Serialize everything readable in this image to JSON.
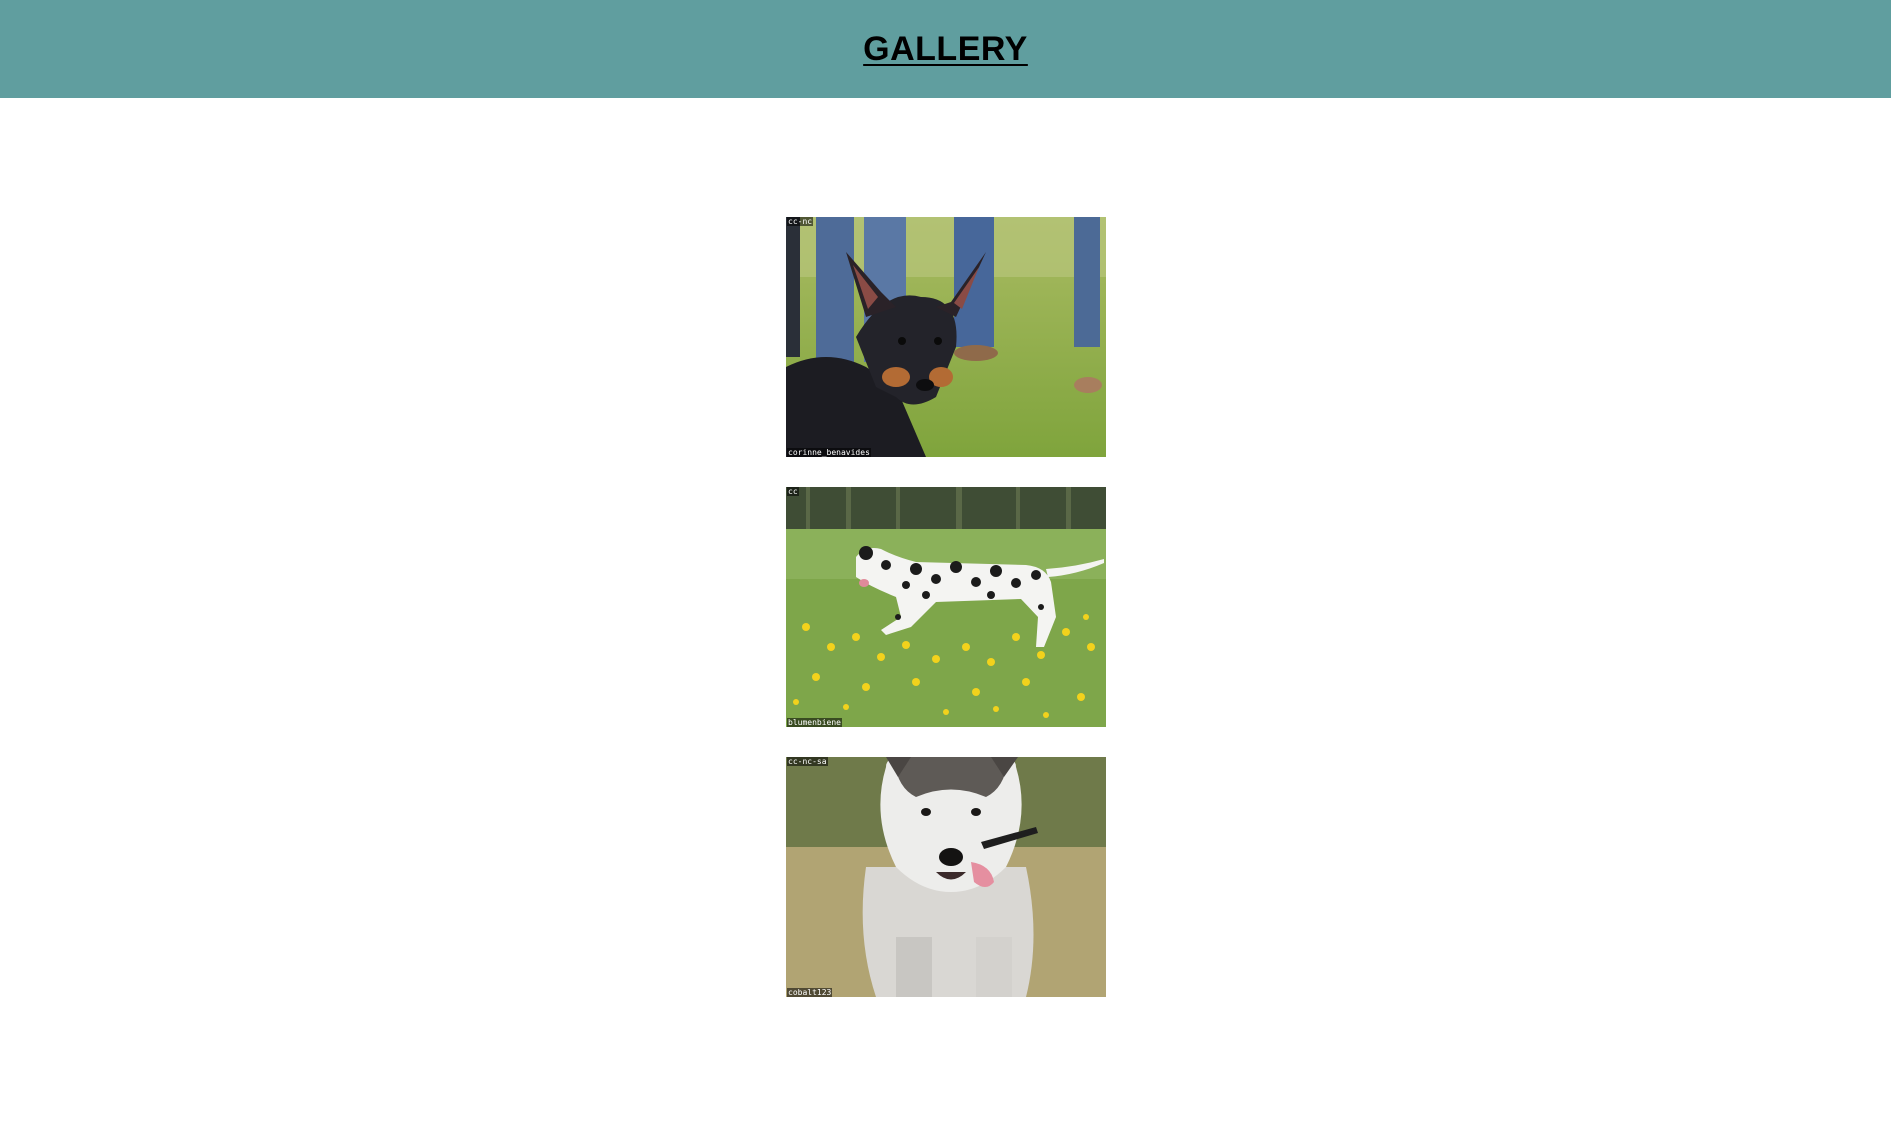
{
  "header": {
    "title": "GALLERY",
    "background": "#609e9f"
  },
  "gallery": {
    "images": [
      {
        "subject": "black-and-tan-terrier",
        "license": "cc-nc",
        "credit": "corinne_benavides"
      },
      {
        "subject": "dalmatian-running",
        "license": "cc",
        "credit": "blumenbiene"
      },
      {
        "subject": "husky-puppy",
        "license": "cc-nc-sa",
        "credit": "cobalt123"
      }
    ]
  }
}
